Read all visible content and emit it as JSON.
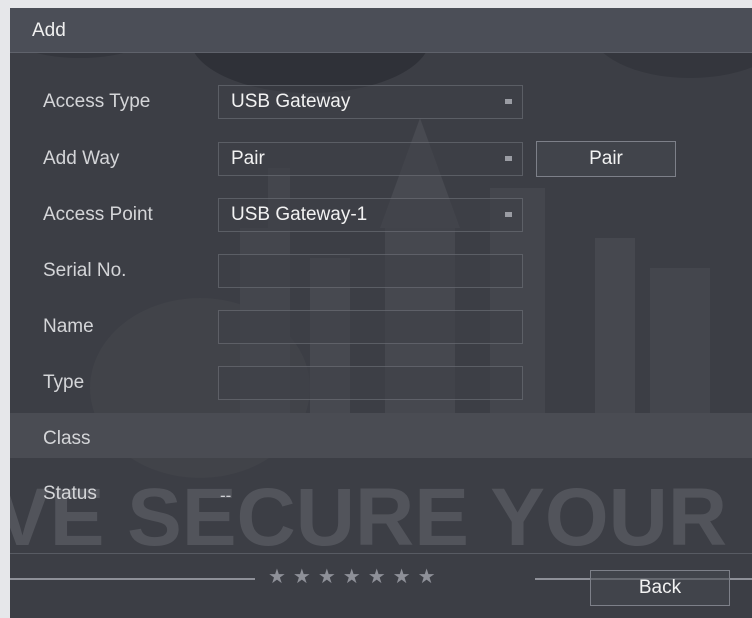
{
  "dialog": {
    "title": "Add",
    "background_slogan": "VE SECURE YOUR LI"
  },
  "form": {
    "access_type": {
      "label": "Access Type",
      "value": "USB Gateway"
    },
    "add_way": {
      "label": "Add Way",
      "value": "Pair",
      "button_label": "Pair"
    },
    "access_point": {
      "label": "Access Point",
      "value": "USB Gateway-1"
    },
    "serial_no": {
      "label": "Serial No.",
      "value": ""
    },
    "name": {
      "label": "Name",
      "value": ""
    },
    "type": {
      "label": "Type",
      "value": ""
    },
    "class": {
      "label": "Class"
    },
    "status": {
      "label": "Status",
      "value": "--"
    }
  },
  "footer": {
    "back_label": "Back",
    "stars": "★★★★★★★"
  },
  "colors": {
    "dialog_bg": "#3c3e45",
    "titlebar_bg": "#4b4e57",
    "text": "#f2f2f2",
    "label": "#d4d5d8"
  }
}
